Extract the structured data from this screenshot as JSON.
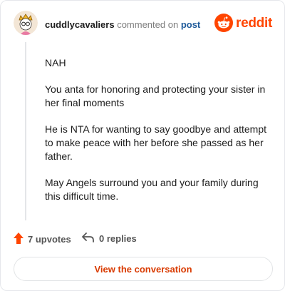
{
  "header": {
    "username": "cuddlycavaliers",
    "commented_on": "commented on",
    "post_link": "post",
    "brand": "reddit"
  },
  "comment": {
    "paragraphs": [
      "NAH",
      "You anta for honoring and protecting your sister in her final moments",
      "He is NTA for wanting to say goodbye and attempt to make peace with her before she passed as her father.",
      "May Angels surround you and your family during this difficult time."
    ]
  },
  "actions": {
    "upvotes": "7 upvotes",
    "replies": "0 replies"
  },
  "footer": {
    "view_button": "View the conversation"
  },
  "colors": {
    "brand": "#ff4500",
    "upvote": "#ff4500",
    "link": "#1e5a9a",
    "button_text": "#d93a00"
  },
  "icons": {
    "avatar": "snoo-avatar",
    "logo": "reddit-logo-icon",
    "upvote": "upvote-arrow-icon",
    "reply": "reply-arrow-icon"
  }
}
